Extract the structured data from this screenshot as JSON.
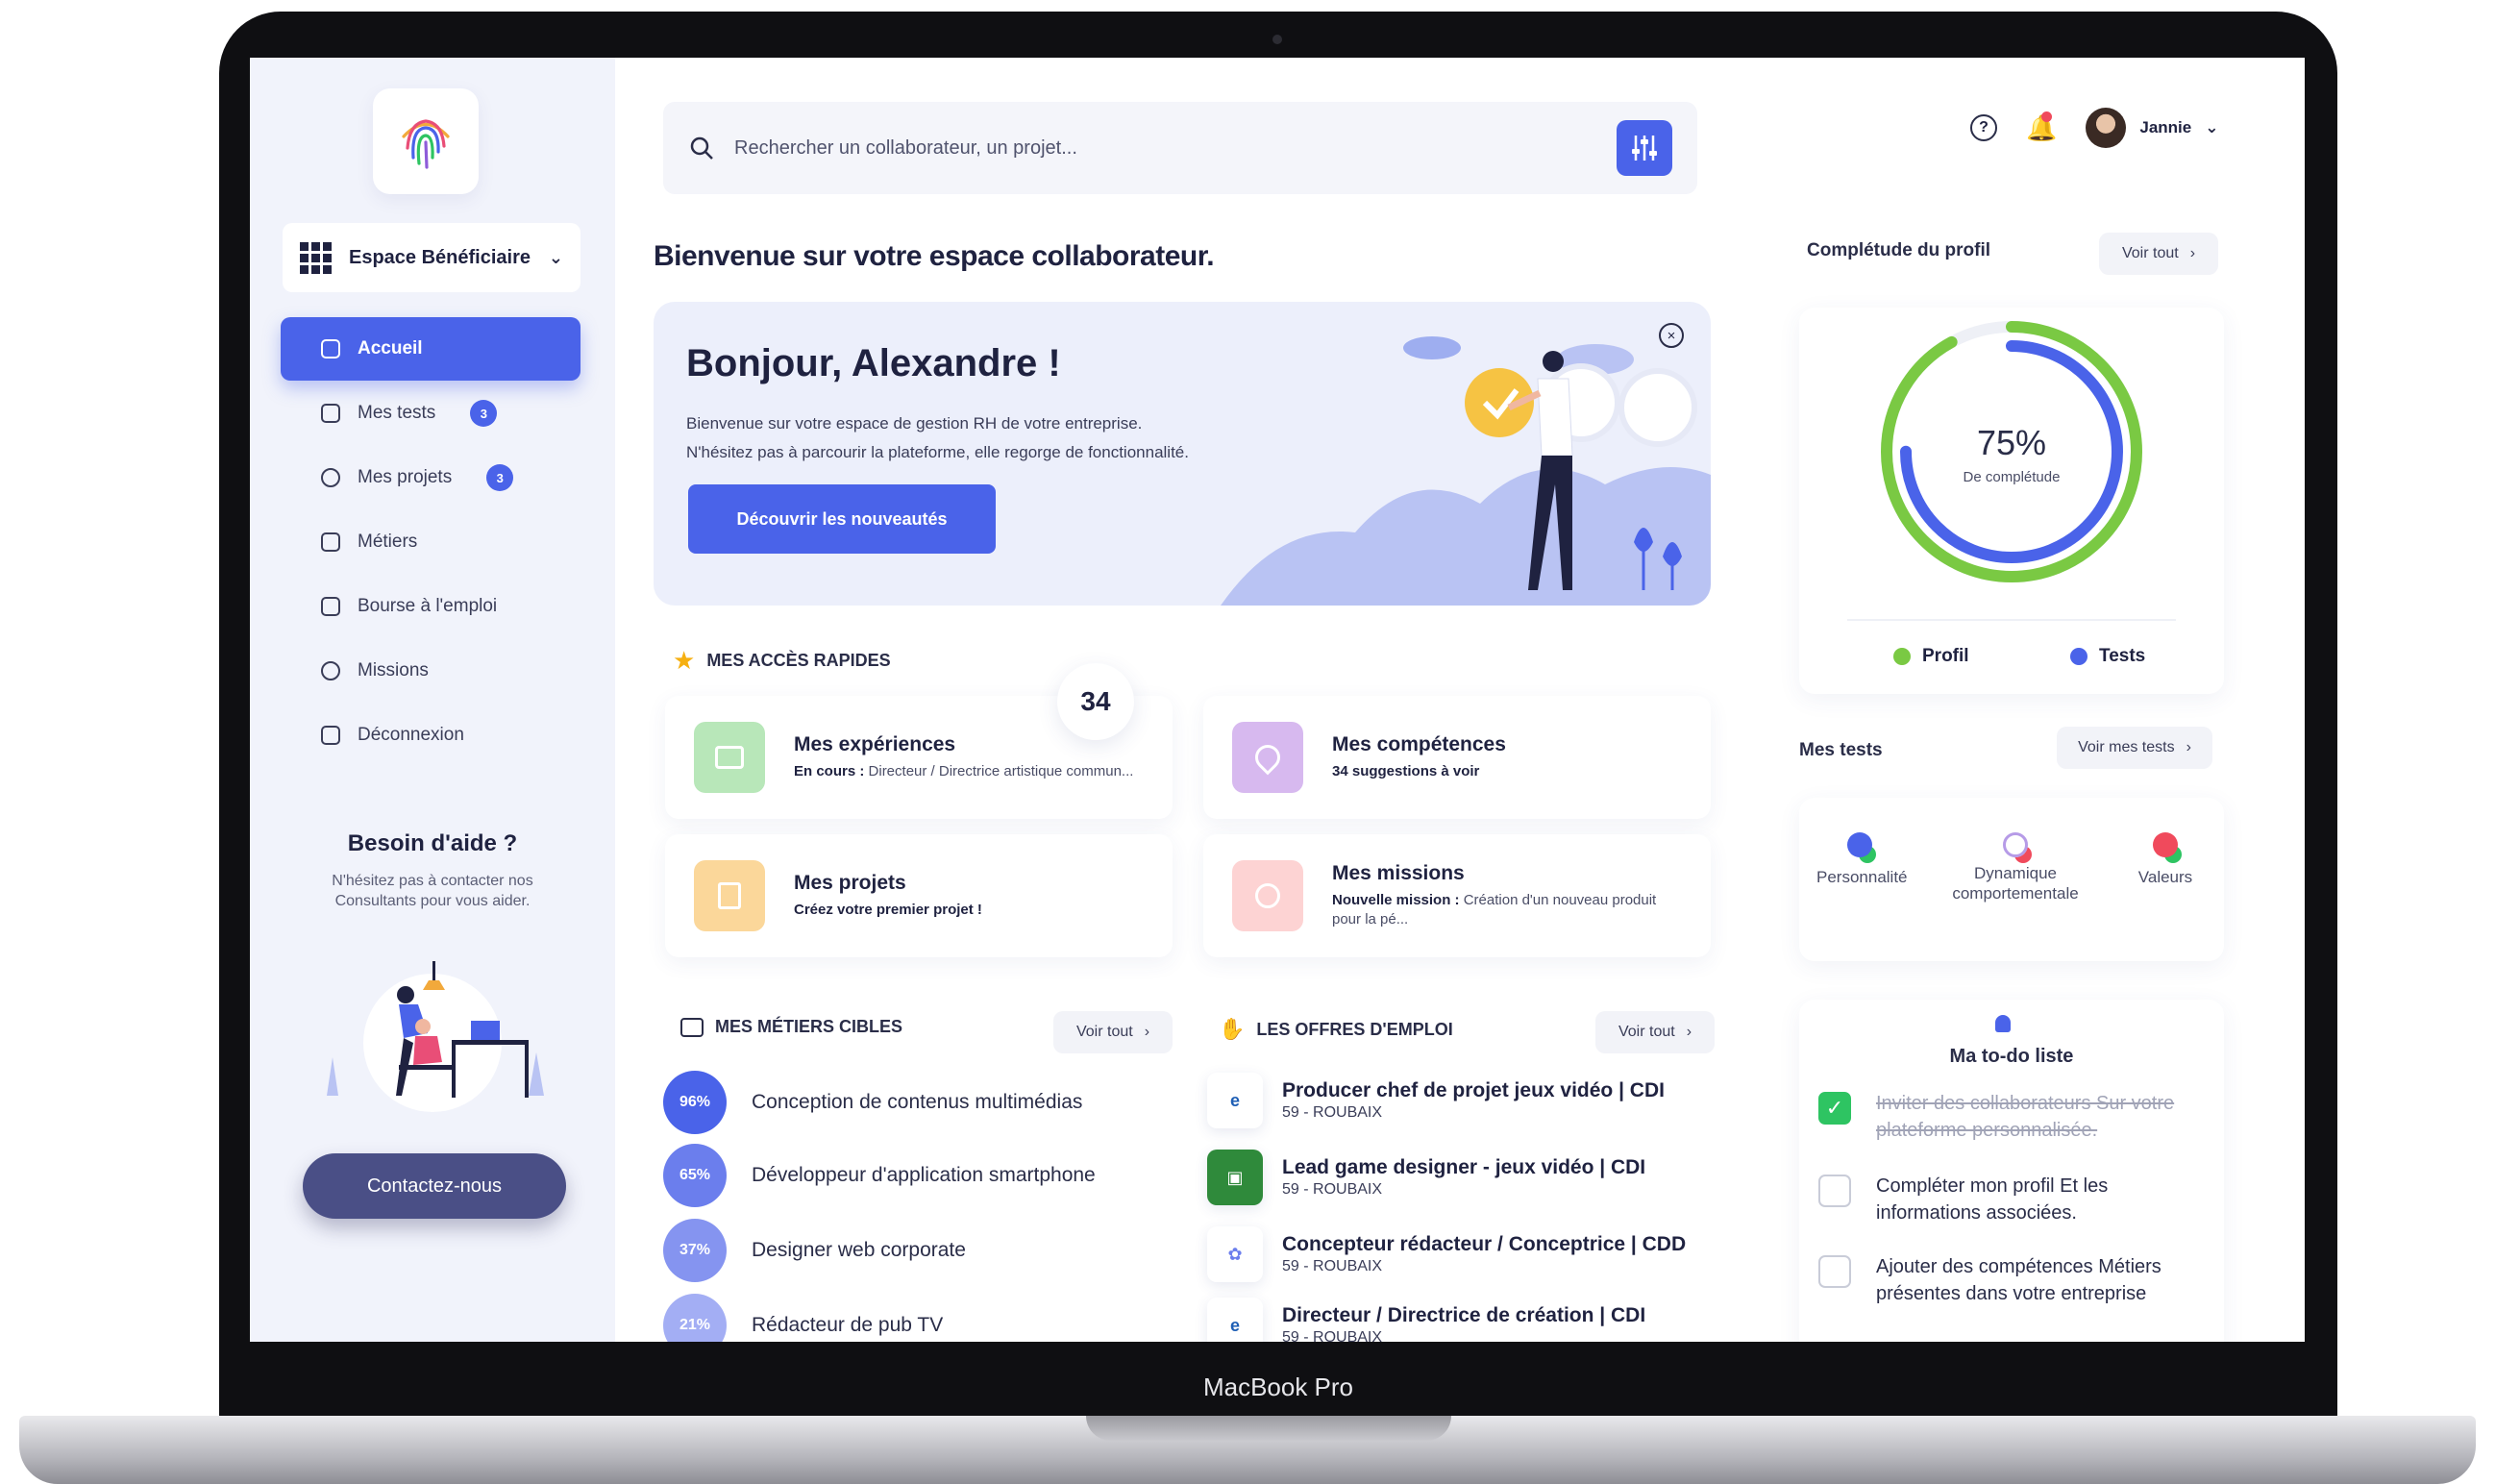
{
  "device": {
    "label": "MacBook Pro"
  },
  "sidebar": {
    "space_label": "Espace Bénéficiaire",
    "items": [
      {
        "label": "Accueil",
        "badge": ""
      },
      {
        "label": "Mes tests",
        "badge": "3"
      },
      {
        "label": "Mes projets",
        "badge": "3"
      },
      {
        "label": "Métiers",
        "badge": ""
      },
      {
        "label": "Bourse à l'emploi",
        "badge": ""
      },
      {
        "label": "Missions",
        "badge": ""
      },
      {
        "label": "Déconnexion",
        "badge": ""
      }
    ],
    "help_title": "Besoin d'aide ?",
    "help_text": "N'hésitez pas à contacter nos Consultants pour vous aider.",
    "contact_label": "Contactez-nous"
  },
  "search": {
    "placeholder": "Rechercher un collaborateur, un projet..."
  },
  "user": {
    "name": "Jannie"
  },
  "welcome": "Bienvenue sur votre espace collaborateur.",
  "hero": {
    "greeting": "Bonjour, Alexandre !",
    "line1": "Bienvenue sur votre espace de gestion RH de votre entreprise.",
    "line2": "N'hésitez pas à parcourir la plateforme, elle regorge de fonctionnalité.",
    "button": "Découvrir les nouveautés"
  },
  "quick": {
    "title": "Mes accès rapides",
    "count": "34",
    "cards": [
      {
        "title": "Mes expériences",
        "sub_strong": "En cours :",
        "sub": " Directeur / Directrice artistique commun..."
      },
      {
        "title": "Mes compétences",
        "sub_strong": "34 suggestions à voir",
        "sub": ""
      },
      {
        "title": "Mes projets",
        "sub_strong": "Créez votre premier projet !",
        "sub": ""
      },
      {
        "title": "Mes missions",
        "sub_strong": "Nouvelle mission :",
        "sub": " Création d'un nouveau produit pour la pé..."
      }
    ]
  },
  "metiers": {
    "title": "Mes métiers cibles",
    "voir": "Voir tout",
    "items": [
      {
        "pct": "96%",
        "label": "Conception de contenus multimédias"
      },
      {
        "pct": "65%",
        "label": "Développeur d'application smartphone"
      },
      {
        "pct": "37%",
        "label": "Designer web corporate"
      },
      {
        "pct": "21%",
        "label": "Rédacteur de pub TV"
      }
    ]
  },
  "offres": {
    "title": "Les offres d'emploi",
    "voir": "Voir tout",
    "items": [
      {
        "title": "Producer chef de projet jeux vidéo | CDI",
        "loc": "59 - ROUBAIX"
      },
      {
        "title": "Lead game designer - jeux vidéo | CDI",
        "loc": "59 - ROUBAIX"
      },
      {
        "title": "Concepteur rédacteur / Conceptrice | CDD",
        "loc": "59 - ROUBAIX"
      },
      {
        "title": "Directeur / Directrice de création | CDI",
        "loc": "59 - ROUBAIX"
      }
    ]
  },
  "profile": {
    "title": "Complétude du profil",
    "voir": "Voir tout",
    "percent": 75,
    "percent_label": "75%",
    "sub": "De complétude",
    "legend_profil": "Profil",
    "legend_tests": "Tests",
    "colors": {
      "profil": "#7ac943",
      "tests": "#4a63e9"
    }
  },
  "tests": {
    "title": "Mes tests",
    "voir": "Voir mes tests",
    "items": [
      "Personnalité",
      "Dynamique comportementale",
      "Valeurs"
    ]
  },
  "todo": {
    "title": "Ma to-do liste",
    "items": [
      {
        "label": "Inviter des collaborateurs Sur votre plateforme personnalisée.",
        "done": true
      },
      {
        "label": "Compléter mon profil Et les informations associées.",
        "done": false
      },
      {
        "label": "Ajouter des compétences Métiers présentes dans votre entreprise",
        "done": false
      }
    ]
  },
  "colors": {
    "accent": "#4a63e9",
    "success": "#2ec462"
  }
}
